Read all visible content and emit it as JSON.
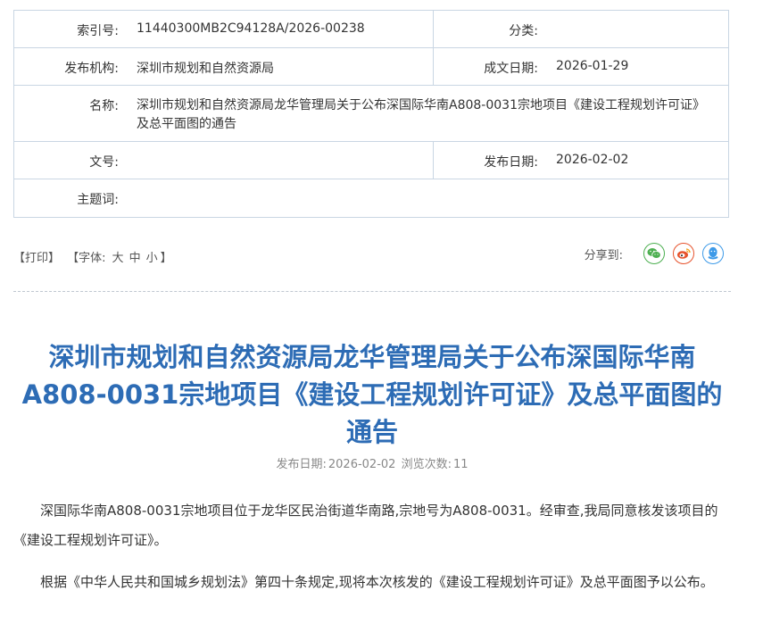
{
  "meta": {
    "index_label": "索引号:",
    "index_value": "11440300MB2C94128A/2026-00238",
    "category_label": "分类:",
    "category_value": "",
    "publisher_label": "发布机构:",
    "publisher_value": "深圳市规划和自然资源局",
    "created_label": "成文日期:",
    "created_value": "2026-01-29",
    "name_label": "名称:",
    "name_value": "深圳市规划和自然资源局龙华管理局关于公布深国际华南A808-0031宗地项目《建设工程规划许可证》及总平面图的通告",
    "docno_label": "文号:",
    "docno_value": "",
    "pubdate_label": "发布日期:",
    "pubdate_value": "2026-02-02",
    "keywords_label": "主题词:",
    "keywords_value": ""
  },
  "toolbar": {
    "print": "【打印】",
    "font_prefix": "【字体:",
    "font_large": "大",
    "font_medium": "中",
    "font_small": "小",
    "font_suffix": "】",
    "share_label": "分享到:"
  },
  "article": {
    "title": "深圳市规划和自然资源局龙华管理局关于公布深国际华南A808-0031宗地项目《建设工程规划许可证》及总平面图的通告",
    "date_label": "发布日期:",
    "date_value": "2026-02-02",
    "views_label": "浏览次数:",
    "views_value": "11",
    "paragraphs": [
      "深国际华南A808-0031宗地项目位于龙华区民治街道华南路,宗地号为A808-0031。经审查,我局同意核发该项目的《建设工程规划许可证》。",
      "根据《中华人民共和国城乡规划法》第四十条规定,现将本次核发的《建设工程规划许可证》及总平面图予以公布。"
    ]
  },
  "colors": {
    "title": "#2d6cb5",
    "border": "#c9d6e3",
    "wechat": "#4caf50",
    "weibo": "#e6532d",
    "qq": "#3d9ae8"
  },
  "icons": [
    "wechat-icon",
    "weibo-icon",
    "qq-icon"
  ]
}
